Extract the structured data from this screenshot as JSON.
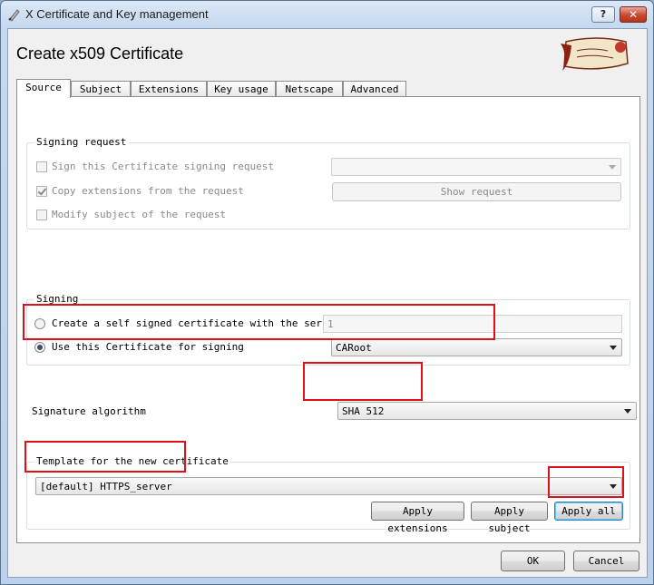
{
  "window": {
    "title": "X Certificate and Key management",
    "help_label": "?",
    "close_label": "✕"
  },
  "heading": "Create x509 Certificate",
  "tabs": [
    {
      "label": "Source",
      "active": true
    },
    {
      "label": "Subject",
      "active": false
    },
    {
      "label": "Extensions",
      "active": false
    },
    {
      "label": "Key usage",
      "active": false
    },
    {
      "label": "Netscape",
      "active": false
    },
    {
      "label": "Advanced",
      "active": false
    }
  ],
  "signing_request": {
    "title": "Signing request",
    "sign_csr": {
      "label": "Sign this Certificate signing request",
      "checked": false,
      "enabled": false
    },
    "copy_extensions": {
      "label": "Copy extensions from the request",
      "checked": true,
      "enabled": false
    },
    "modify_subject": {
      "label": "Modify subject of the request",
      "checked": false,
      "enabled": false
    },
    "request_select": {
      "value": ""
    },
    "show_request_label": "Show request"
  },
  "signing": {
    "title": "Signing",
    "self_signed": {
      "label": "Create a self signed certificate with the serial",
      "selected": false
    },
    "serial_value": "1",
    "use_ca": {
      "label": "Use this Certificate for signing",
      "selected": true
    },
    "ca_select": {
      "value": "CARoot"
    }
  },
  "signature_algorithm": {
    "label": "Signature algorithm",
    "value": "SHA 512"
  },
  "template": {
    "title": "Template for the new certificate",
    "select_value": "[default] HTTPS_server",
    "apply_extensions_label": "Apply extensions",
    "apply_subject_label": "Apply subject",
    "apply_all_label": "Apply all"
  },
  "buttons": {
    "ok_label": "OK",
    "cancel_label": "Cancel"
  },
  "colors": {
    "highlight": "#e0101b",
    "titlebar": "#c5d8ee",
    "close_button": "#c9482f"
  }
}
